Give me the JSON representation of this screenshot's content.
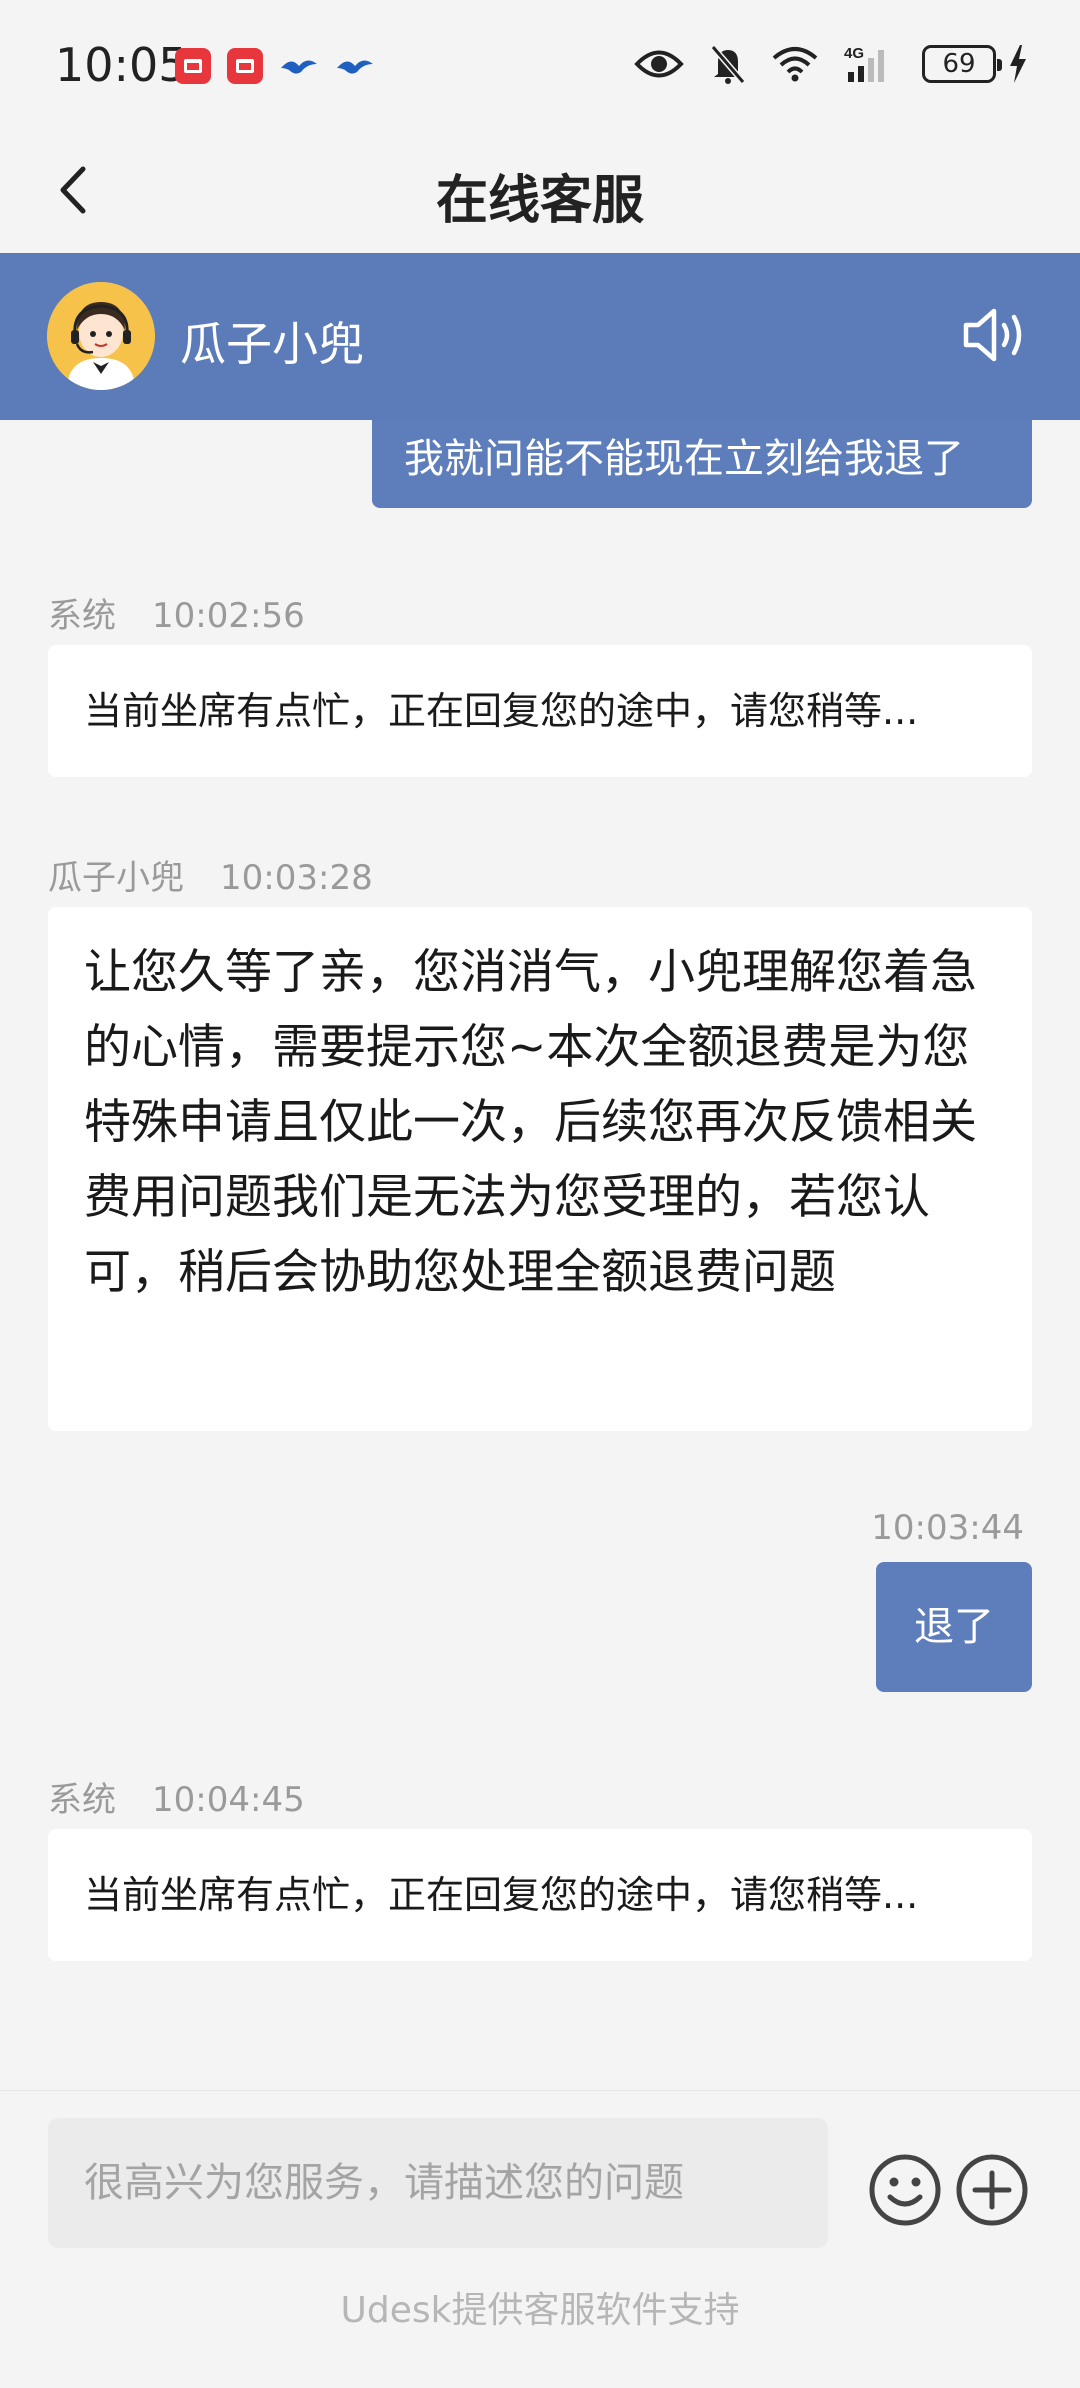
{
  "status_bar": {
    "time": "10:05",
    "battery": "69",
    "network": "4G"
  },
  "nav": {
    "title": "在线客服"
  },
  "agent": {
    "name": "瓜子小兜"
  },
  "messages": {
    "m0": {
      "sender": "me",
      "text": "我就问能不能现在立刻给我退了"
    },
    "m1": {
      "sender": "系统",
      "time": "10:02:56",
      "text": "当前坐席有点忙，正在回复您的途中，请您稍等..."
    },
    "m2": {
      "sender": "瓜子小兜",
      "time": "10:03:28",
      "text": "让您久等了亲，您消消气，小兜理解您着急的心情，需要提示您~本次全额退费是为您特殊申请且仅此一次，后续您再次反馈相关费用问题我们是无法为您受理的，若您认可，稍后会协助您处理全额退费问题"
    },
    "m3": {
      "sender": "me",
      "time": "10:03:44",
      "text": "退了"
    },
    "m4": {
      "sender": "系统",
      "time": "10:04:45",
      "text": "当前坐席有点忙，正在回复您的途中，请您稍等..."
    }
  },
  "input": {
    "placeholder": "很高兴为您服务，请描述您的问题"
  },
  "footer": {
    "text": "Udesk提供客服软件支持"
  },
  "colors": {
    "accent": "#5d7dbb",
    "background": "#f4f4f4",
    "bubble_left": "#ffffff"
  },
  "icons": [
    "back-arrow-icon",
    "speaker-icon",
    "emoji-icon",
    "plus-icon",
    "eye-icon",
    "bell-off-icon",
    "wifi-icon",
    "signal-icon",
    "battery-icon",
    "charging-icon"
  ]
}
